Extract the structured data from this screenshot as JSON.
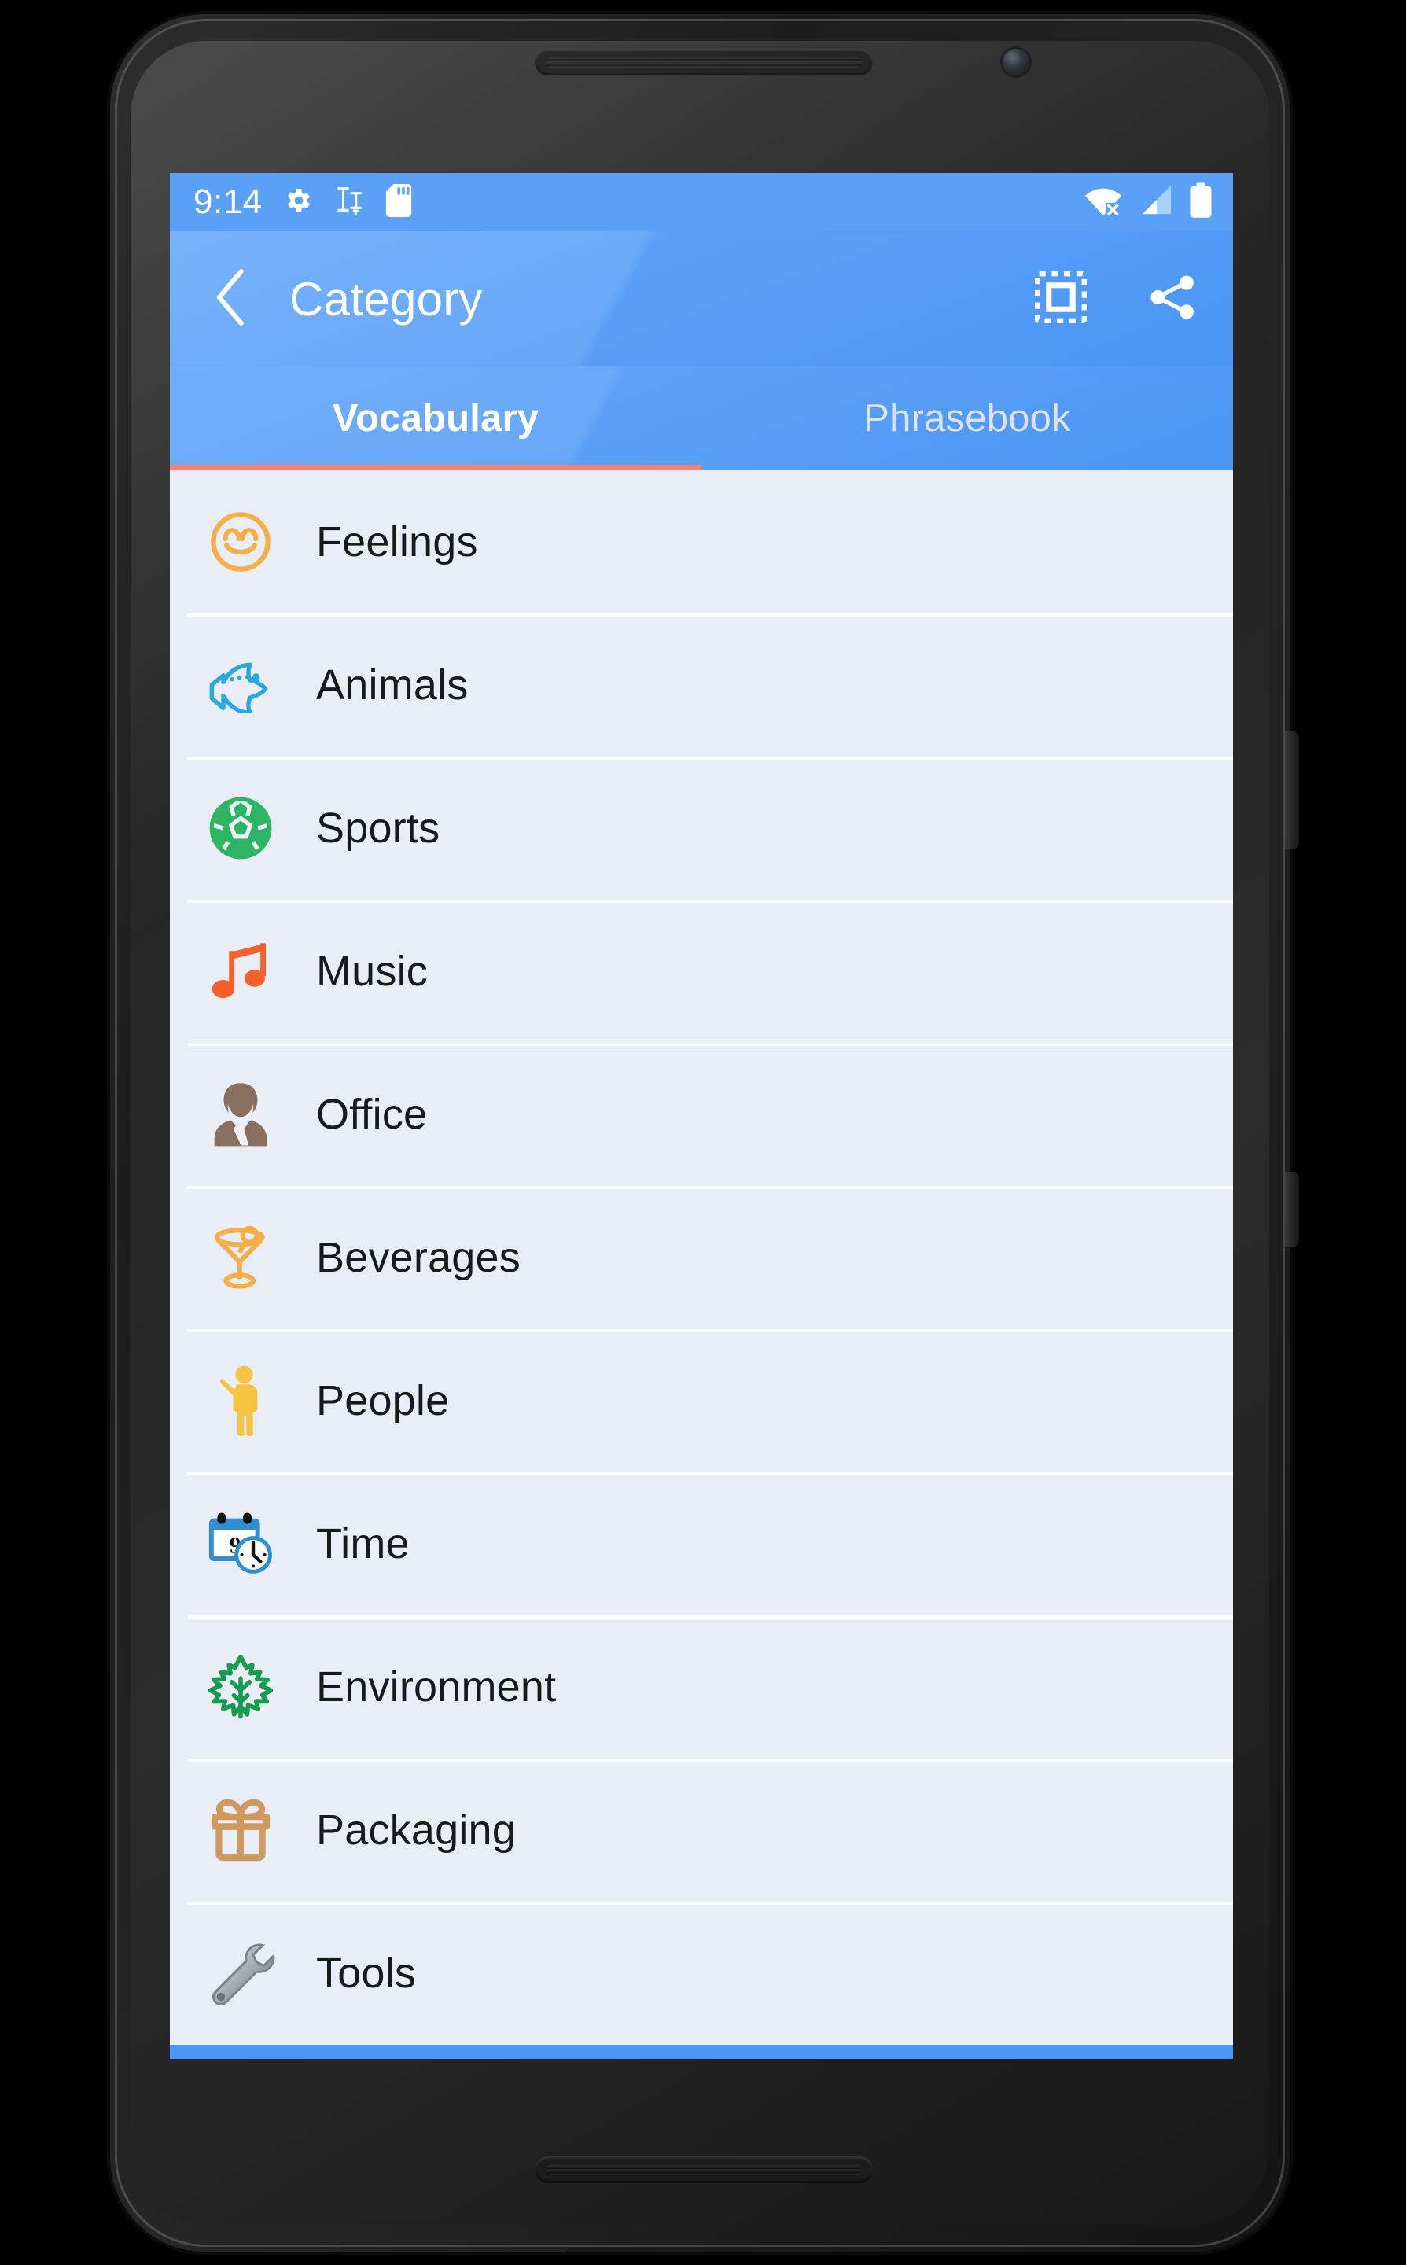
{
  "status_bar": {
    "time": "9:14",
    "left_icons": [
      "gear-icon",
      "text-format-icon",
      "sd-card-icon"
    ],
    "right_icons": [
      "wifi-off-icon",
      "cell-signal-icon",
      "battery-full-icon"
    ]
  },
  "app_bar": {
    "back_icon": "back-chevron-icon",
    "title": "Category",
    "actions": [
      {
        "icon": "select-all-icon",
        "name": "select-mode-button"
      },
      {
        "icon": "share-icon",
        "name": "share-button"
      }
    ]
  },
  "tabs": {
    "items": [
      {
        "label": "Vocabulary",
        "active": true
      },
      {
        "label": "Phrasebook",
        "active": false
      }
    ],
    "indicator_color": "#f0827a"
  },
  "list": {
    "items": [
      {
        "label": "Feelings",
        "icon": "smiley-face-icon",
        "color": "#f5ae4a"
      },
      {
        "label": "Animals",
        "icon": "fish-icon",
        "color": "#29a8e0"
      },
      {
        "label": "Sports",
        "icon": "soccer-ball-icon",
        "color": "#2eb563"
      },
      {
        "label": "Music",
        "icon": "music-note-icon",
        "color": "#f4602a"
      },
      {
        "label": "Office",
        "icon": "office-worker-icon",
        "color": "#8a6f5e"
      },
      {
        "label": "Beverages",
        "icon": "cocktail-icon",
        "color": "#f5ae4a"
      },
      {
        "label": "People",
        "icon": "person-wave-icon",
        "color": "#f7c444"
      },
      {
        "label": "Time",
        "icon": "calendar-clock-icon",
        "color": "#2f8fd0"
      },
      {
        "label": "Environment",
        "icon": "maple-leaf-icon",
        "color": "#169b50"
      },
      {
        "label": "Packaging",
        "icon": "gift-box-icon",
        "color": "#cf9a5f"
      },
      {
        "label": "Tools",
        "icon": "wrench-icon",
        "color": "#9aa0a6"
      }
    ]
  },
  "nav_bar": {
    "buttons": [
      {
        "name": "nav-back-button",
        "icon": "triangle-back-icon"
      },
      {
        "name": "nav-home-button",
        "icon": "circle-home-icon"
      },
      {
        "name": "nav-recents-button",
        "icon": "square-recents-icon"
      }
    ],
    "background": "#4a95f5",
    "icon_color": "#c5ddfb"
  },
  "theme": {
    "primary": "#5aa0f7",
    "primary_dark": "#4a95f5",
    "list_background": "#e9edf6",
    "text": "#18191b"
  }
}
